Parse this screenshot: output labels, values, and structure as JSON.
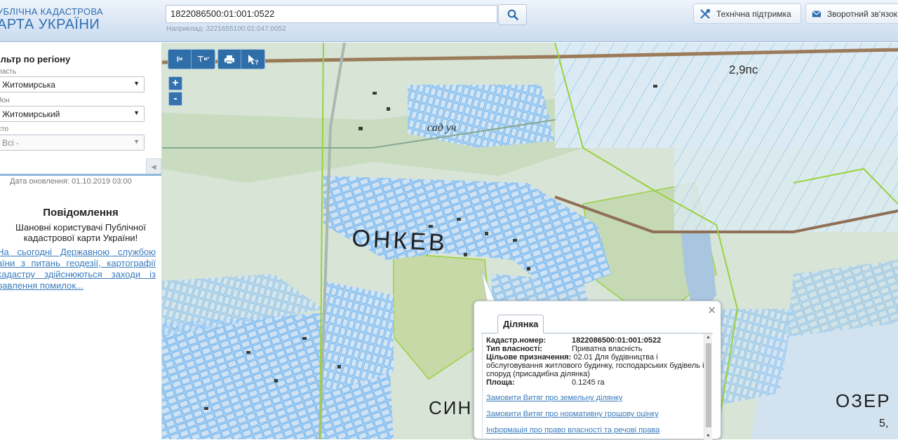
{
  "header": {
    "logo_line1": "УБЛІЧНА КАДАСТРОВА",
    "logo_line2": "АРТА УКРАЇНИ",
    "search_value": "1822086500:01:001:0522",
    "search_hint": "Наприклад: 3221655100:01:047:0052",
    "support_label": "Технічна підтримка",
    "feedback_label": "Зворотний зв'язок"
  },
  "sidebar": {
    "filter_title": "ільтр по регіону",
    "region_label": "ласть",
    "region_value": "Житомирська",
    "district_label": "йон",
    "district_value": "Житомирський",
    "city_label": "сто",
    "city_value": "Всі -",
    "updated": "Дата оновлення: 01.10.2019 03:00",
    "message_title": "Повідомлення",
    "message_body": "Шановні користувачі Публічної кадастрової карти України!",
    "message_link": "На сьогодні Державною службою аїни з питань геодезії, картографії кадастру здійснюються заходи із равлення помилок..."
  },
  "map": {
    "tools": [
      {
        "label": "I м",
        "icon": "ruler-line-icon"
      },
      {
        "label": "⊤ м²",
        "icon": "ruler-area-icon"
      },
      {
        "label": "print",
        "icon": "print-icon"
      },
      {
        "label": "?",
        "icon": "identify-cursor-icon"
      }
    ],
    "zoom_in": "+",
    "zoom_out": "-",
    "labels": [
      {
        "text": "2,9пс"
      },
      {
        "text": "сад уч"
      },
      {
        "text": "ОЗЕР"
      },
      {
        "text": "5,"
      }
    ]
  },
  "popup": {
    "tab_label": "Ділянка",
    "fields": [
      {
        "key": "Кадастр.номер:",
        "value": "1822086500:01:001:0522"
      },
      {
        "key": "Тип власності:",
        "value": "Приватна власність"
      },
      {
        "key": "Цільове призначення:",
        "value": "02.01 Для будівництва і обслуговування житлового будинку, господарських будівель і споруд (присадибна ділянка)"
      },
      {
        "key": "Площа:",
        "value": "0.1245 га"
      }
    ],
    "links": [
      "Замовити Витяг про земельну ділянку",
      "Замовити Витяг про нормативну грошову оцінку",
      "Інформація про право власності та речові права"
    ]
  },
  "colors": {
    "parcel_outline": "#6fb4ee",
    "boundary_green": "#9ad13e",
    "header_accent": "#2f6eb0"
  }
}
